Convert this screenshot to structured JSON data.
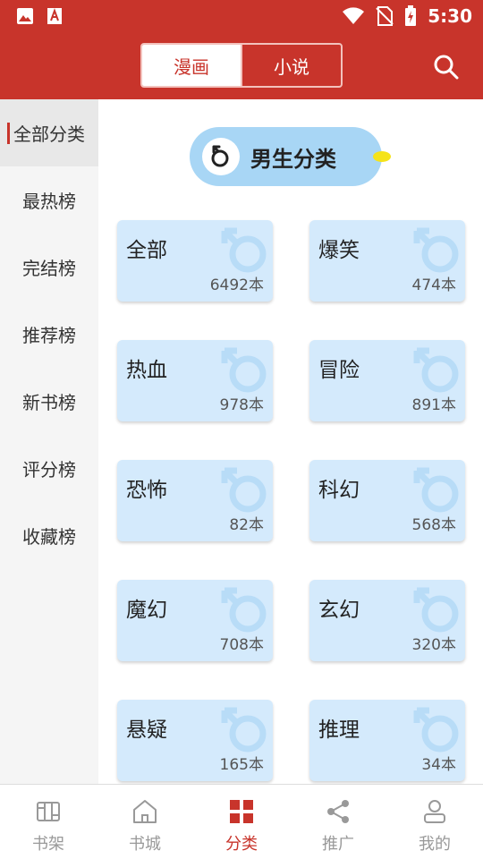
{
  "status_bar": {
    "time": "5:30"
  },
  "header": {
    "tabs": [
      {
        "label": "漫画",
        "active": true
      },
      {
        "label": "小说",
        "active": false
      }
    ]
  },
  "sidebar": {
    "items": [
      {
        "label": "全部分类",
        "active": true
      },
      {
        "label": "最热榜"
      },
      {
        "label": "完结榜"
      },
      {
        "label": "推荐榜"
      },
      {
        "label": "新书榜"
      },
      {
        "label": "评分榜"
      },
      {
        "label": "收藏榜"
      }
    ]
  },
  "category": {
    "title": "男生分类",
    "items": [
      {
        "name": "全部",
        "count": "6492本"
      },
      {
        "name": "爆笑",
        "count": "474本"
      },
      {
        "name": "热血",
        "count": "978本"
      },
      {
        "name": "冒险",
        "count": "891本"
      },
      {
        "name": "恐怖",
        "count": "82本"
      },
      {
        "name": "科幻",
        "count": "568本"
      },
      {
        "name": "魔幻",
        "count": "708本"
      },
      {
        "name": "玄幻",
        "count": "320本"
      },
      {
        "name": "悬疑",
        "count": "165本"
      },
      {
        "name": "推理",
        "count": "34本"
      }
    ]
  },
  "bottom_nav": {
    "items": [
      {
        "label": "书架",
        "icon": "bookshelf-icon"
      },
      {
        "label": "书城",
        "icon": "home-icon"
      },
      {
        "label": "分类",
        "icon": "category-icon",
        "active": true
      },
      {
        "label": "推广",
        "icon": "share-icon"
      },
      {
        "label": "我的",
        "icon": "user-icon"
      }
    ]
  },
  "colors": {
    "brand": "#c8342b",
    "card_bg": "#d4eafc",
    "category_pill": "#a8d6f5"
  }
}
